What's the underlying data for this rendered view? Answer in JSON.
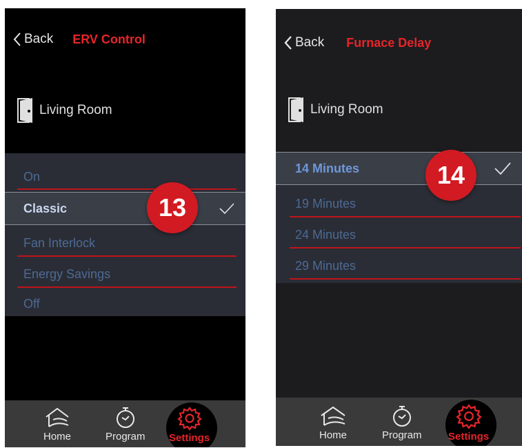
{
  "left": {
    "back_label": "Back",
    "title": "ERV Control",
    "room": "Living Room",
    "options": [
      "On",
      "Classic",
      "Fan Interlock",
      "Energy Savings",
      "Off"
    ],
    "selected_index": 1,
    "badge": "13",
    "tabs": {
      "home": "Home",
      "program": "Program",
      "settings": "Settings"
    }
  },
  "right": {
    "back_label": "Back",
    "title": "Furnace Delay",
    "room": "Living Room",
    "options": [
      "14 Minutes",
      "19 Minutes",
      "24 Minutes",
      "29 Minutes"
    ],
    "selected_index": 0,
    "badge": "14",
    "tabs": {
      "home": "Home",
      "program": "Program",
      "settings": "Settings"
    }
  },
  "colors": {
    "accent": "#e5252a",
    "badge": "#d21a22",
    "option_text": "#4d6a93",
    "divider": "#c1131a"
  },
  "icons": [
    "chevron-left-icon",
    "door-icon",
    "checkmark-icon",
    "home-icon",
    "stopwatch-icon",
    "gear-icon"
  ]
}
